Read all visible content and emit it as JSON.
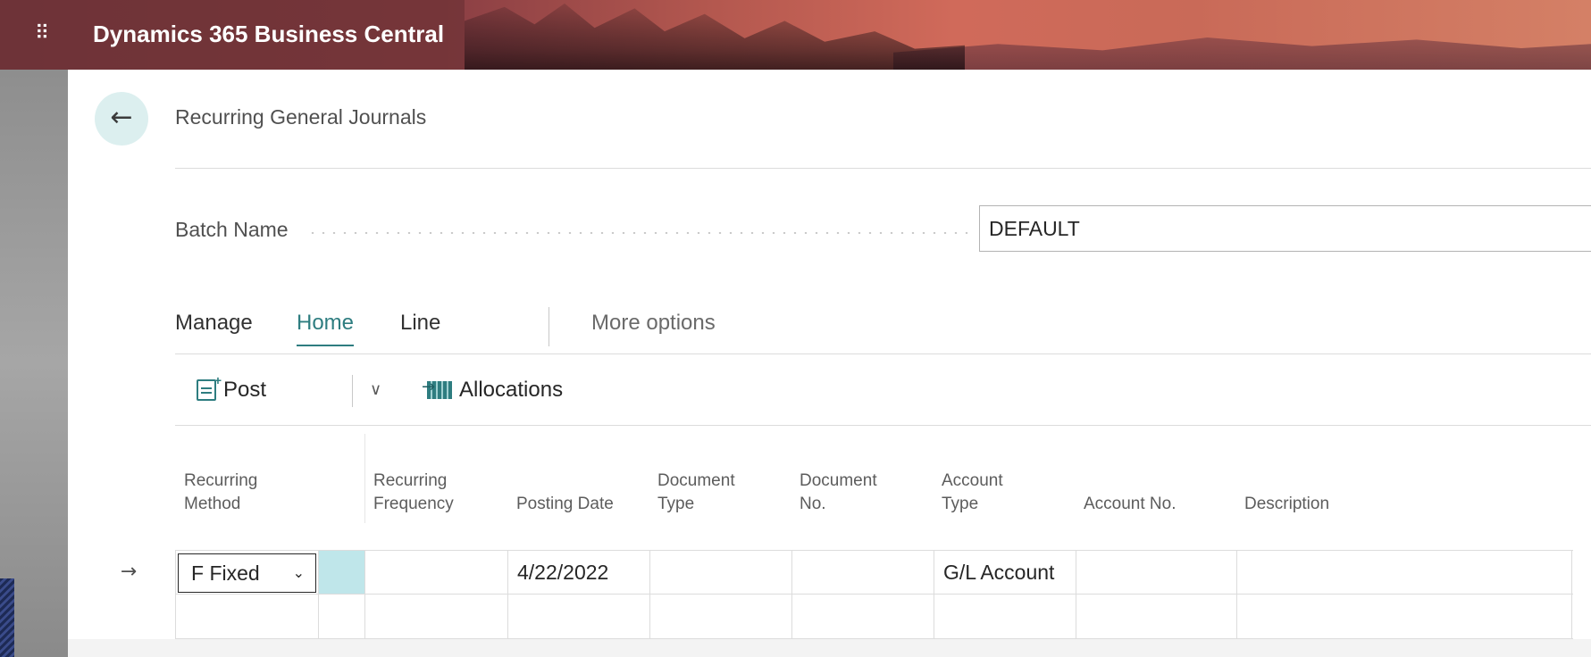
{
  "app": {
    "title": "Dynamics 365 Business Central",
    "waffle_glyph": "⠿"
  },
  "page": {
    "back_glyph": "←",
    "title": "Recurring General Journals"
  },
  "batch": {
    "label": "Batch Name",
    "value": "DEFAULT"
  },
  "tabs": [
    {
      "label": "Manage",
      "active": false
    },
    {
      "label": "Home",
      "active": true
    },
    {
      "label": "Line",
      "active": false
    },
    {
      "label": "More options",
      "active": false
    }
  ],
  "toolbar": {
    "post_label": "Post",
    "chevron_glyph": "∨",
    "allocations_label": "Allocations"
  },
  "grid": {
    "headers": {
      "recurring_method": [
        "Recurring",
        "Method"
      ],
      "recurring_frequency": [
        "Recurring",
        "Frequency"
      ],
      "posting_date": [
        "Posting Date"
      ],
      "document_type": [
        "Document",
        "Type"
      ],
      "document_no": [
        "Document",
        "No."
      ],
      "account_type": [
        "Account",
        "Type"
      ],
      "account_no": [
        "Account No."
      ],
      "description": [
        "Description"
      ]
    },
    "row_indicator": "→",
    "rows": [
      {
        "recurring_method": "F Fixed",
        "recurring_frequency": "",
        "posting_date": "4/22/2022",
        "document_type": "",
        "document_no": "",
        "account_type": "G/L Account",
        "account_no": "",
        "description": ""
      },
      {
        "recurring_method": "",
        "recurring_frequency": "",
        "posting_date": "",
        "document_type": "",
        "document_no": "",
        "account_type": "",
        "account_no": "",
        "description": ""
      }
    ],
    "select_caret": "⌄"
  },
  "colors": {
    "accent": "#2e7d80",
    "selected_cell": "#bfe6ea",
    "appbar": "#b4584f"
  }
}
